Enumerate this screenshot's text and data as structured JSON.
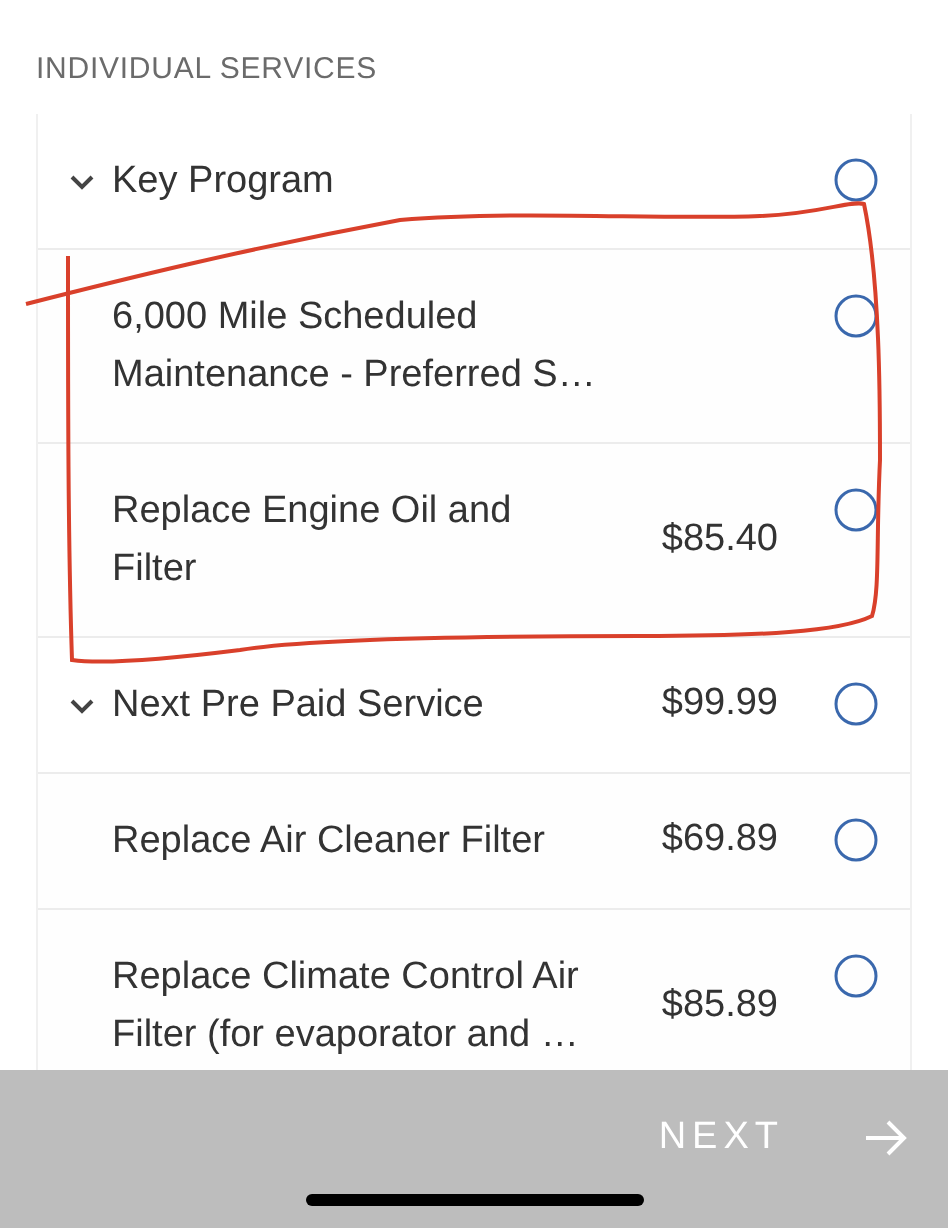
{
  "section_title": "INDIVIDUAL SERVICES",
  "services": [
    {
      "kind": "group",
      "label": "Key Program",
      "expanded": true,
      "selected": false
    },
    {
      "kind": "item",
      "label": "6,000 Mile Scheduled Maintenance - Preferred S…",
      "selected": false
    },
    {
      "kind": "item",
      "label": "Replace Engine Oil and Filter",
      "price": "$85.40",
      "selected": false
    },
    {
      "kind": "group",
      "label": "Next Pre Paid Service",
      "price": "$99.99",
      "expanded": true,
      "selected": false
    },
    {
      "kind": "item",
      "label": "Replace Air Cleaner Filter",
      "price": "$69.89",
      "selected": false
    },
    {
      "kind": "item",
      "label": "Replace Climate Control Air Filter (for evaporator and …",
      "price": "$85.89",
      "selected": false
    }
  ],
  "next_button": {
    "label": "NEXT",
    "disabled": true
  }
}
